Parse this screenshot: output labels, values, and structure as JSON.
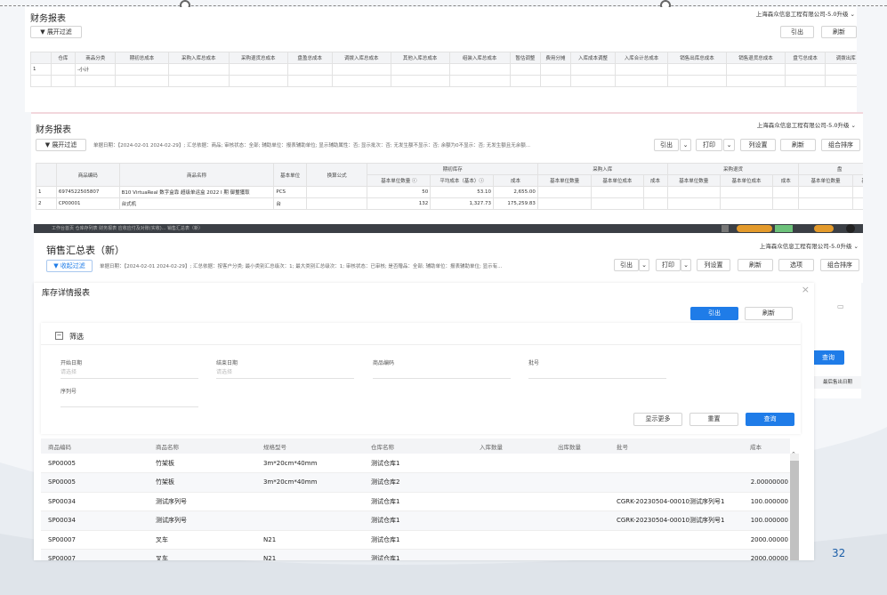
{
  "slide": {
    "page_number": "32"
  },
  "panel1": {
    "title": "财务报表",
    "company": "上海森众信息工程有限公司-5.0升级 ⌄",
    "filter_btn": "展开过滤",
    "export_btn": "引出",
    "refresh_btn": "刷新",
    "headers": [
      "仓库",
      "商品分类",
      "期初总成本",
      "采购入库总成本",
      "采购退货总成本",
      "盘盈总成本",
      "调拨入库总成本",
      "其他入库总成本",
      "组装入库总成本",
      "暂估调整",
      "费用分摊",
      "入库成本调整",
      "入库合计总成本",
      "销售出库总成本",
      "销售退货总成本",
      "盘亏总成本",
      "调拨出库"
    ],
    "rows": [
      {
        "idx": "1",
        "cat": "-小计"
      }
    ]
  },
  "panel2": {
    "title": "财务报表",
    "company": "上海森众信息工程有限公司-5.0升级 ⌄",
    "filter_btn": "展开过滤",
    "info": "单据日期：【2024-02-01 2024-02-29】; 汇总依据：商品; 审核状态：全部; 辅助单位：报表辅助单位; 显示辅助属性：否; 显示批次：否; 无发生额不显示：否; 余额为0不显示：否; 无发生额且无余额...",
    "export_btn": "引出",
    "print_btn": "打印",
    "colset_btn": "列设置",
    "refresh_btn": "刷新",
    "sort_btn": "组合排序",
    "h_code": "商品编码",
    "h_name": "商品名称",
    "h_unit": "基本单位",
    "h_formula": "换算公式",
    "h_end": "期初库存",
    "h_pin": "采购入库",
    "h_pret": "采购退货",
    "h_cut": "盘",
    "sub": [
      "基本单位数量 ⓘ",
      "平均成本（基本）ⓘ",
      "成本",
      "基本单位数量",
      "基本单位成本",
      "成本",
      "基本单位数量",
      "基本单位成本",
      "成本",
      "基本单位数量",
      "基本"
    ],
    "rows": [
      {
        "idx": "1",
        "code": "6974522505807",
        "name": "B10 VirtuaReal 数字盒靠 超级单运盒 2022 I 期 御璽獲取",
        "unit": "PCS",
        "qty": "50",
        "avg": "53.10",
        "cost": "2,655.00"
      },
      {
        "idx": "2",
        "code": "CP00001",
        "name": "台式机",
        "unit": "台",
        "qty": "132",
        "avg": "1,327.73",
        "cost": "175,259.83"
      }
    ]
  },
  "panel3": {
    "tabs": "工作台首页   仓库存列表   财务报表   应收应付及对账(实收)...   销售汇总表（新）",
    "title": "销售汇总表（新）",
    "company": "上海森众信息工程有限公司-5.0升级 ⌄",
    "filter_btn": "收起过滤",
    "info": "单据日期：【2024-02-01 2024-02-29】; 汇总依据：按客户分类; 最小类别汇总级次：1; 最大类别汇总级次：1; 审核状态：已审核; 是否赠品：全部; 辅助单位：报表辅助单位; 显示有...",
    "export_btn": "引出",
    "print_btn": "打印",
    "colset_btn": "列设置",
    "refresh_btn": "刷新",
    "option_btn": "选项",
    "sort_btn": "组合排序",
    "query_btn": "查询",
    "col_last": "最后售出日期"
  },
  "dialog": {
    "title": "库存详情报表",
    "export_btn": "引出",
    "refresh_btn": "刷新",
    "filter_title": "筛选",
    "f_start": "开始日期",
    "f_start_ph": "请选择",
    "f_end": "结束日期",
    "f_end_ph": "请选择",
    "f_code": "商品编码",
    "f_batch": "批号",
    "f_serial": "序列号",
    "more_btn": "显示更多",
    "reset_btn": "重置",
    "query_btn": "查询",
    "columns": [
      "商品编码",
      "商品名称",
      "规格型号",
      "仓库名称",
      "入库数量",
      "出库数量",
      "批号",
      "成本"
    ],
    "rows": [
      [
        "SP00005",
        "竹架板",
        "3m*20cm*40mm",
        "测试仓库1",
        "",
        "",
        "",
        ""
      ],
      [
        "SP00005",
        "竹架板",
        "3m*20cm*40mm",
        "测试仓库2",
        "",
        "",
        "",
        "2.00000000"
      ],
      [
        "SP00034",
        "测试序列号",
        "",
        "测试仓库1",
        "",
        "",
        "CGRK-20230504-00010测试序列号1",
        "100.000000"
      ],
      [
        "SP00034",
        "测试序列号",
        "",
        "测试仓库1",
        "",
        "",
        "CGRK-20230504-00010测试序列号1",
        "100.000000"
      ],
      [
        "SP00007",
        "叉车",
        "N21",
        "测试仓库1",
        "",
        "",
        "",
        "2000.00000"
      ],
      [
        "SP00007",
        "叉车",
        "N21",
        "测试仓库1",
        "",
        "",
        "",
        "2000.00000"
      ]
    ]
  },
  "colors": {
    "accent": "#1f7ce8",
    "primary_text": "#222222",
    "border": "#e2e2e2"
  }
}
